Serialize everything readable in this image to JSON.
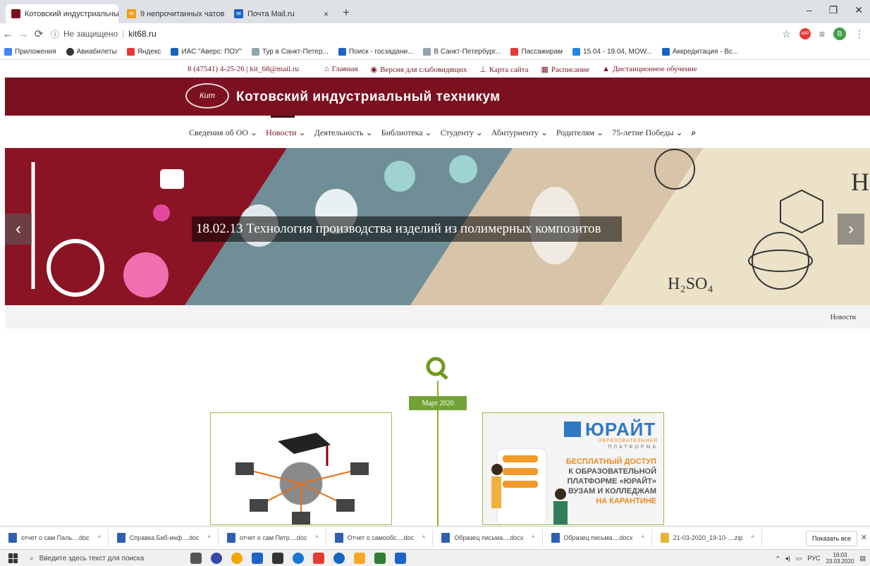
{
  "browser": {
    "tabs": [
      {
        "title": "Котовский индустриальный те",
        "active": true
      },
      {
        "title": "9 непрочитанных чатов",
        "active": false
      },
      {
        "title": "Почта Mail.ru",
        "active": false
      }
    ],
    "address": {
      "security": "Не защищено",
      "url": "kit68.ru"
    },
    "bookmarks": [
      "Приложения",
      "Авиабилеты",
      "Яндекс",
      "ИАС \"Аверс: ПОУ\"",
      "Тур в Санкт-Петер...",
      "Поиск - госзадани...",
      "В Санкт-Петербург...",
      "Пассажирам",
      "15.04 - 19.04, MOW...",
      "Аккредитация - Вс..."
    ],
    "avatar_letter": "В",
    "colors": {
      "tabbar": "#dee1e6"
    }
  },
  "site": {
    "contact": "8 (47541) 4-25-26 | kit_68@mail.ru",
    "top_links": [
      "Главная",
      "Версия для слабовидящих",
      "Карта сайта",
      "Расписание",
      "Дистанционное обучение"
    ],
    "logo_text": "Кит",
    "title": "Котовский индустриальный техникум",
    "menu": [
      "Сведения об ОО",
      "Новости",
      "Деятельность",
      "Библиотека",
      "Студенту",
      "Абитуриенту",
      "Родителям",
      "75-летие Победы"
    ],
    "active_menu": "Новости",
    "hero_caption": "18.02.13 Технология производства изделий из полимерных композитов",
    "breadcrumb": "Новости",
    "timeline_month": "Март 2020",
    "urait": {
      "brand": "ЮРАЙТ",
      "sub1": "ОБРАЗОВАТЕЛЬНАЯ",
      "sub2": "ПЛАТФОРМА",
      "line1": "БЕСПЛАТНЫЙ ДОСТУП",
      "line2": "К ОБРАЗОВАТЕЛЬНОЙ",
      "line3": "ПЛАТФОРМЕ «ЮРАЙТ»",
      "line4": "ВУЗАМ И КОЛЛЕДЖАМ",
      "line5": "НА КАРАНТИНЕ"
    },
    "colors": {
      "brand": "#7b1120",
      "accent_green": "#72a334"
    }
  },
  "downloads": {
    "items": [
      "отчет о сам Паль....doc",
      "Справка Биб-инф....doc",
      "отчет о сам Петр....doc",
      "Отчет о самообс....doc",
      "Образец письма....docx",
      "Образец письма....docx",
      "21-03-2020_19-10-....zip"
    ],
    "show_all": "Показать все"
  },
  "taskbar": {
    "search_placeholder": "Введите здесь текст для поиска",
    "lang": "РУС",
    "time": "16:03",
    "date": "23.03.2020"
  }
}
